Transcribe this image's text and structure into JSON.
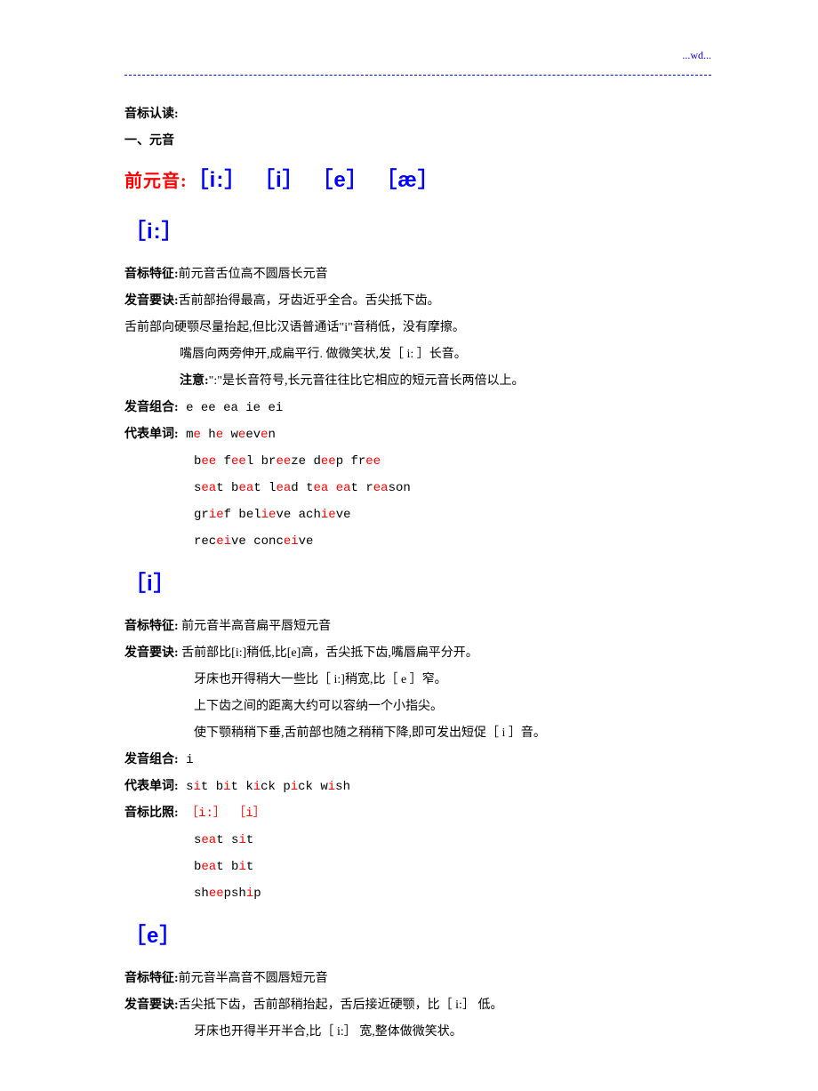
{
  "header": {
    "wd": "...wd..."
  },
  "intro": {
    "title1": "音标认读:",
    "title2": "一、元音"
  },
  "front_vowels_label": "前元音:",
  "front_vowels_ipa": "［i:］ ［i］ ［e］ ［æ］",
  "sec_ii": {
    "ipa": "［i:］",
    "feat_label": "音标特征:",
    "feat_text": "前元音舌位高不圆唇长元音",
    "key_label": "发音要诀:",
    "key_text": "舌前部抬得最高，牙齿近乎全合。舌尖抵下齿。",
    "line2": "舌前部向硬颚尽量抬起,但比汉语普通话\"i\"音稍低，没有摩擦。",
    "line3": "嘴唇向两旁伸开,成扁平行. 做微笑状,发［ i: ］长音。",
    "note_label": "注意:",
    "note_text": "\":\"是长音符号,长元音往往比它相应的短元音长两倍以上。",
    "combo_label": "发音组合:",
    "combo_text": " e   ee   ea   ie   ei",
    "words_label": "代表单词:"
  },
  "sec_i": {
    "ipa": "［i］",
    "feat_label": "音标特征:",
    "feat_text": " 前元音半高音扁平唇短元音",
    "key_label": "发音要诀:",
    "key_text": " 舌前部比[i:]稍低,比[e]高，舌尖抵下齿,嘴唇扁平分开。",
    "line2": "牙床也开得稍大一些比［ i:]稍宽,比［ e ］窄。",
    "line3": "上下齿之间的距离大约可以容纳一个小指尖。",
    "line4": "使下颚稍稍下垂,舌前部也随之稍稍下降,即可发出短促［ i ］音。",
    "combo_label": "发音组合:",
    "combo_text": "  i",
    "words_label": "代表单词:",
    "compare_label": "音标比照:"
  },
  "sec_e": {
    "ipa": "［e］",
    "feat_label": "音标特征:",
    "feat_text": "前元音半高音不圆唇短元音",
    "key_label": "发音要诀:",
    "key_text": "舌尖抵下齿，舌前部稍抬起，舌后接近硬颚，比［ i:］ 低。",
    "line2": "牙床也开得半开半合,比［ i:］ 宽,整体做微笑状。"
  }
}
